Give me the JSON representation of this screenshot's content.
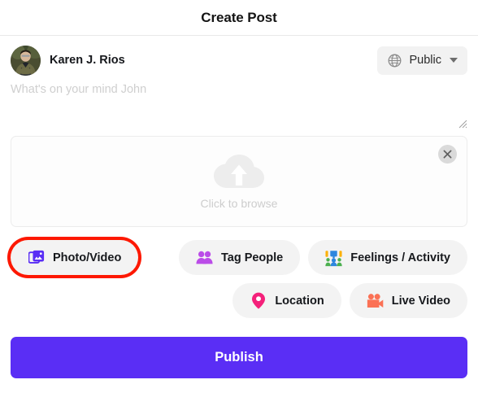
{
  "header": {
    "title": "Create Post"
  },
  "author": {
    "name": "Karen J. Rios",
    "avatar_icon": "user-photo-avatar"
  },
  "privacy": {
    "label": "Public",
    "icon": "globe-icon",
    "chevron_icon": "chevron-down-icon",
    "icon_color": "#8a8a8a",
    "options": [
      "Public"
    ]
  },
  "composer": {
    "value": "",
    "placeholder": "What's on your mind John",
    "resize_handle_icon": "resize-grip-icon"
  },
  "dropzone": {
    "label": "Click to browse",
    "upload_icon": "cloud-upload-icon",
    "close_icon": "close-icon",
    "icon_color": "#ededed"
  },
  "actions": [
    {
      "label": "Photo/Video",
      "icon": "photo-video-icon",
      "icon_color": "#5a2ef5",
      "highlighted": true
    },
    {
      "label": "Tag People",
      "icon": "tag-people-icon",
      "icon_color": "#bb4ce8",
      "highlighted": false
    },
    {
      "label": "Feelings / Activity",
      "icon": "feelings-activity-icon",
      "icon_color": "#2e86de",
      "highlighted": false
    },
    {
      "label": "Location",
      "icon": "location-pin-icon",
      "icon_color": "#f4217a",
      "highlighted": false
    },
    {
      "label": "Live Video",
      "icon": "live-video-icon",
      "icon_color": "#fb7155",
      "highlighted": false
    }
  ],
  "publish": {
    "label": "Publish",
    "color": "#5a2ef5"
  }
}
